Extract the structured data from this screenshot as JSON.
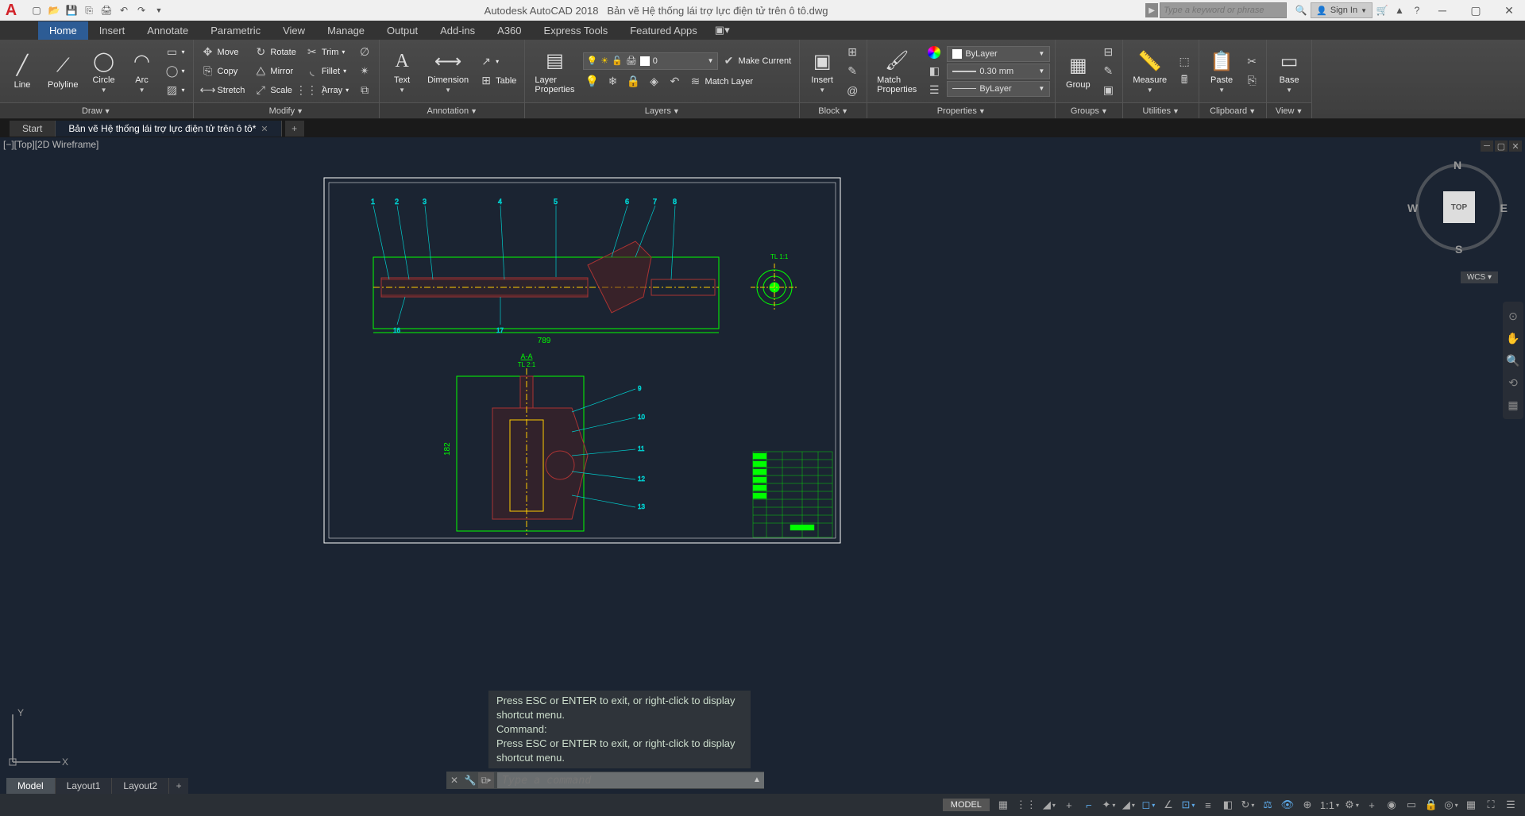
{
  "title": {
    "app": "Autodesk AutoCAD 2018",
    "doc": "Bản vẽ Hệ thống lái trợ lực điện tử trên ô tô.dwg",
    "search_placeholder": "Type a keyword or phrase",
    "signin": "Sign In"
  },
  "tabs": [
    "Home",
    "Insert",
    "Annotate",
    "Parametric",
    "View",
    "Manage",
    "Output",
    "Add-ins",
    "A360",
    "Express Tools",
    "Featured Apps"
  ],
  "active_tab": "Home",
  "ribbon": {
    "draw": {
      "title": "Draw",
      "line": "Line",
      "polyline": "Polyline",
      "circle": "Circle",
      "arc": "Arc"
    },
    "modify": {
      "title": "Modify",
      "move": "Move",
      "rotate": "Rotate",
      "trim": "Trim",
      "copy": "Copy",
      "mirror": "Mirror",
      "fillet": "Fillet",
      "stretch": "Stretch",
      "scale": "Scale",
      "array": "Array"
    },
    "annotation": {
      "title": "Annotation",
      "text": "Text",
      "dimension": "Dimension",
      "table": "Table"
    },
    "layers": {
      "title": "Layers",
      "layer_props": "Layer\nProperties",
      "current_layer": "0",
      "make_current": "Make Current",
      "match_layer": "Match Layer"
    },
    "block": {
      "title": "Block",
      "insert": "Insert"
    },
    "properties": {
      "title": "Properties",
      "match": "Match\nProperties",
      "color": "ByLayer",
      "lineweight": "0.30 mm",
      "linetype": "ByLayer"
    },
    "groups": {
      "title": "Groups",
      "group": "Group"
    },
    "utilities": {
      "title": "Utilities",
      "measure": "Measure"
    },
    "clipboard": {
      "title": "Clipboard",
      "paste": "Paste"
    },
    "view": {
      "title": "View",
      "base": "Base"
    }
  },
  "file_tabs": {
    "start": "Start",
    "doc": "Bản vẽ Hệ thống lái trợ lực điện tử trên ô tô*"
  },
  "viewport_label": "[−][Top][2D Wireframe]",
  "viewcube": {
    "top": "TOP",
    "n": "N",
    "e": "E",
    "s": "S",
    "w": "W",
    "wcs": "WCS"
  },
  "drawing": {
    "dim1": "789",
    "dim2": "182",
    "section": "A-A",
    "scale1": "TL 2:1",
    "scale2": "TL 1:1",
    "callouts_top": [
      "1",
      "2",
      "3",
      "4",
      "5",
      "6",
      "7",
      "8"
    ],
    "callouts_bottom": [
      "16",
      "17"
    ],
    "callouts_right": [
      "9",
      "10",
      "11",
      "12",
      "13"
    ]
  },
  "cmd": {
    "hist1": "Press ESC or ENTER to exit, or right-click to display shortcut menu.",
    "hist2": "Command:",
    "hist3": "Press ESC or ENTER to exit, or right-click to display shortcut menu.",
    "placeholder": "Type a command"
  },
  "layouts": [
    "Model",
    "Layout1",
    "Layout2"
  ],
  "status": {
    "model": "MODEL",
    "scale": "1:1"
  }
}
